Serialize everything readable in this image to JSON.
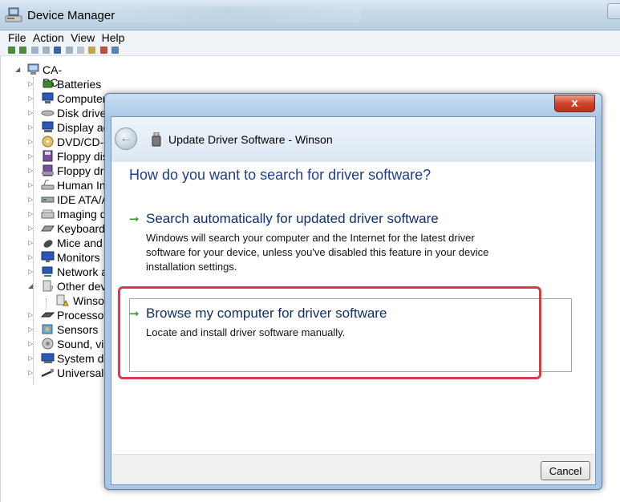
{
  "window": {
    "title": "Device Manager"
  },
  "menu": [
    "File",
    "Action",
    "View",
    "Help"
  ],
  "tree": {
    "root": "CA-PC",
    "items": [
      {
        "label": "Batteries",
        "icon": "battery-icon"
      },
      {
        "label": "Computer",
        "icon": "computer-icon"
      },
      {
        "label": "Disk drive",
        "icon": "disk-drive-icon"
      },
      {
        "label": "Display ad",
        "icon": "display-adapter-icon"
      },
      {
        "label": "DVD/CD-R",
        "icon": "dvd-drive-icon"
      },
      {
        "label": "Floppy dis",
        "icon": "floppy-disk-icon"
      },
      {
        "label": "Floppy dri",
        "icon": "floppy-drive-icon"
      },
      {
        "label": "Human In",
        "icon": "hid-icon"
      },
      {
        "label": "IDE ATA/A",
        "icon": "ide-controller-icon"
      },
      {
        "label": "Imaging d",
        "icon": "imaging-device-icon"
      },
      {
        "label": "Keyboards",
        "icon": "keyboard-icon"
      },
      {
        "label": "Mice and",
        "icon": "mouse-icon"
      },
      {
        "label": "Monitors",
        "icon": "monitor-icon"
      },
      {
        "label": "Network a",
        "icon": "network-adapter-icon"
      },
      {
        "label": "Other dev",
        "icon": "unknown-device-icon"
      },
      {
        "label": "Winson",
        "icon": "warning-device-icon"
      },
      {
        "label": "Processors",
        "icon": "processor-icon"
      },
      {
        "label": "Sensors",
        "icon": "sensor-icon"
      },
      {
        "label": "Sound, vic",
        "icon": "sound-icon"
      },
      {
        "label": "System de",
        "icon": "system-device-icon"
      },
      {
        "label": "Universal",
        "icon": "usb-controller-icon"
      }
    ]
  },
  "dialog": {
    "title": "Update Driver Software - Winson",
    "close_label": "x",
    "question": "How do you want to search for driver software?",
    "option_auto": {
      "title": "Search automatically for updated driver software",
      "desc_lines": [
        "Windows will search your computer and the Internet for the latest driver",
        "software for your device, unless you've disabled this feature in your device",
        "installation settings."
      ]
    },
    "option_browse": {
      "title": "Browse my computer for driver software",
      "desc": "Locate and install driver software manually."
    },
    "cancel_label": "Cancel"
  },
  "colors": {
    "accent_text": "#1e3d8f",
    "option_arrow": "#2a9d2a",
    "highlight_border": "#d83b43",
    "close_button": "#d0442c"
  }
}
